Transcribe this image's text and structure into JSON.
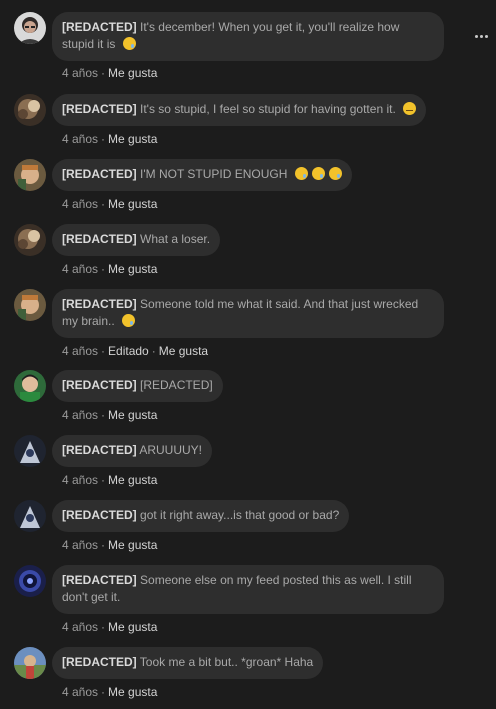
{
  "comments": [
    {
      "author": "[REDACTED]",
      "text": "It's december! When you get it, you'll realize how stupid it is",
      "emojis": [
        "sad"
      ],
      "time": "4 años",
      "like": "Me gusta"
    },
    {
      "author": "[REDACTED]",
      "text": "It's so stupid, I feel so stupid for having gotten it.",
      "emojis": [
        "meh"
      ],
      "time": "4 años",
      "like": "Me gusta"
    },
    {
      "author": "[REDACTED]",
      "text": "I'M NOT STUPID ENOUGH",
      "emojis": [
        "sad",
        "sad",
        "sad"
      ],
      "time": "4 años",
      "like": "Me gusta"
    },
    {
      "author": "[REDACTED]",
      "text": "What a loser.",
      "emojis": [],
      "time": "4 años",
      "like": "Me gusta"
    },
    {
      "author": "[REDACTED]",
      "text": "Someone told me what it said. And that just wrecked my brain..",
      "emojis": [
        "sad"
      ],
      "time": "4 años",
      "edited": "Editado",
      "like": "Me gusta"
    },
    {
      "author": "[REDACTED]",
      "text": "[REDACTED]",
      "emojis": [],
      "time": "4 años",
      "like": "Me gusta"
    },
    {
      "author": "[REDACTED]",
      "text": "ARUUUUY!",
      "emojis": [],
      "time": "4 años",
      "like": "Me gusta"
    },
    {
      "author": "[REDACTED]",
      "text": "got it right away...is that good or bad?",
      "emojis": [],
      "time": "4 años",
      "like": "Me gusta"
    },
    {
      "author": "[REDACTED]",
      "text": "Someone else on my feed posted this as well. I still don't get it.",
      "emojis": [],
      "time": "4 años",
      "like": "Me gusta"
    },
    {
      "author": "[REDACTED]",
      "text": "Took me a bit but.. *groan* Haha",
      "emojis": [],
      "time": "4 años",
      "like": "Me gusta"
    }
  ],
  "colors": {
    "background": "#1c1c1c",
    "bubble": "#2e2e2e",
    "author": "#dadada",
    "text": "#a9a9a9",
    "meta": "#9b9b9b"
  },
  "icons": {
    "more": "more-options-icon",
    "emoji_sad": "crying-face-emoji-icon",
    "emoji_meh": "expressionless-face-emoji-icon"
  }
}
